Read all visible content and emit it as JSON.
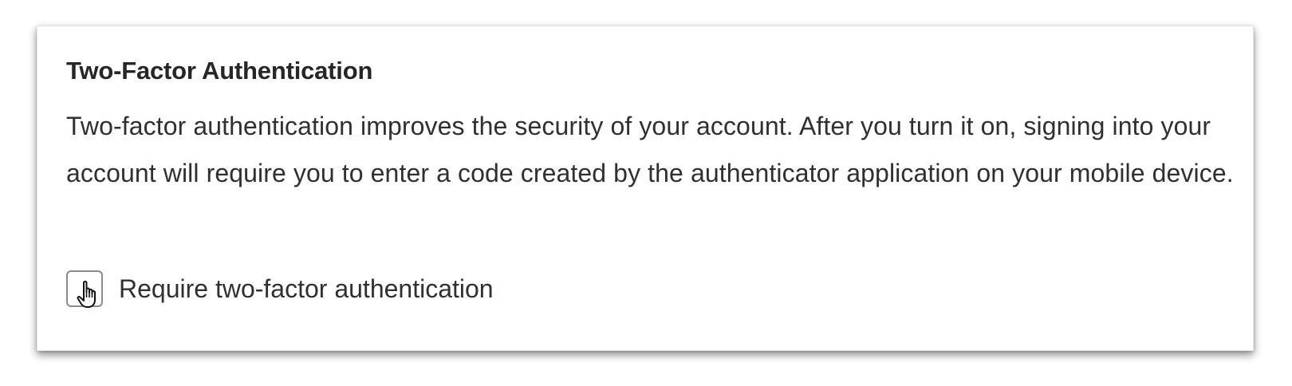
{
  "section": {
    "title": "Two-Factor Authentication",
    "description": "Two-factor authentication improves the security of your account. After you turn it on, signing into your account will require you to enter a code created by the authenticator application on your mobile device."
  },
  "option": {
    "label": "Require two-factor authentication",
    "checked": false
  },
  "cursor": {
    "icon": "pointer-hand-icon"
  }
}
